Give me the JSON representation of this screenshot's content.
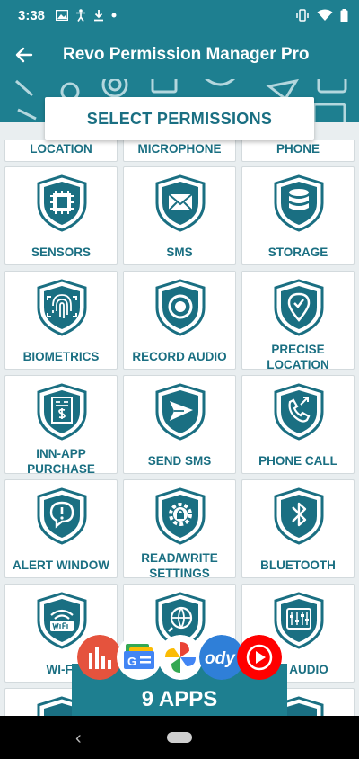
{
  "status_bar": {
    "time": "3:38",
    "left_icons": [
      "image-icon",
      "accessibility-icon",
      "download-icon",
      "dot-icon"
    ],
    "right_icons": [
      "vibrate-icon",
      "wifi-icon",
      "battery-icon"
    ]
  },
  "app_bar": {
    "title": "Revo Permission Manager Pro",
    "back_icon": "arrow-left-icon"
  },
  "header": {
    "select_label": "SELECT PERMISSIONS"
  },
  "permissions": [
    {
      "label": "LOCATION",
      "icon": "location-icon"
    },
    {
      "label": "MICROPHONE",
      "icon": "microphone-icon"
    },
    {
      "label": "PHONE",
      "icon": "phone-icon"
    },
    {
      "label": "SENSORS",
      "icon": "chip-icon"
    },
    {
      "label": "SMS",
      "icon": "envelope-icon"
    },
    {
      "label": "STORAGE",
      "icon": "database-icon"
    },
    {
      "label": "BIOMETRICS",
      "icon": "fingerprint-icon"
    },
    {
      "label": "RECORD AUDIO",
      "icon": "record-icon"
    },
    {
      "label": "PRECISE LOCATION",
      "label_lines": [
        "PRECISE",
        "LOCATION"
      ],
      "icon": "location-check-icon"
    },
    {
      "label": "INN-APP PURCHASE",
      "label_lines": [
        "INN-APP",
        "PURCHASE"
      ],
      "icon": "receipt-icon"
    },
    {
      "label": "SEND SMS",
      "icon": "send-icon"
    },
    {
      "label": "PHONE CALL",
      "icon": "phone-call-icon"
    },
    {
      "label": "ALERT WINDOW",
      "icon": "alert-bubble-icon"
    },
    {
      "label": "READ/WRITE SETTINGS",
      "label_lines": [
        "READ/WRITE",
        "SETTINGS"
      ],
      "icon": "gear-lock-icon"
    },
    {
      "label": "BLUETOOTH",
      "icon": "bluetooth-icon"
    },
    {
      "label": "Wi-Fi",
      "icon": "wifi-icon"
    },
    {
      "label": "",
      "icon": "globe-icon"
    },
    {
      "label": "MODIFY AUDIO",
      "visible_label": "IFY AUDIO",
      "icon": "mixer-icon"
    }
  ],
  "apps_banner": {
    "count_label": "9 APPS",
    "app_icons": [
      "bar-chart-app-icon",
      "google-news-app-icon",
      "google-photos-app-icon",
      "body-app-icon",
      "youtube-music-app-icon"
    ]
  },
  "nav_bar": {
    "back_icon": "nav-back-icon",
    "home_icon": "nav-home-icon"
  },
  "colors": {
    "primary": "#1e7f90",
    "text": "#1a6f82",
    "tile_bg": "#ffffff",
    "page_bg": "#e9eef0"
  }
}
